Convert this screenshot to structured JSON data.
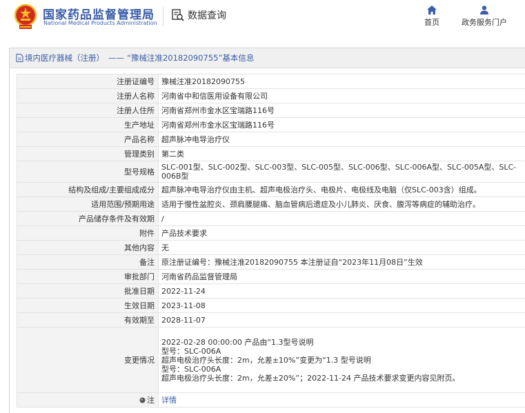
{
  "header": {
    "agency_cn": "国家药品监督管理局",
    "agency_en": "National Medical Products Administration",
    "data_query": "数据查询",
    "nav_home": "首页",
    "nav_portal": "政务服务门户"
  },
  "titlebar": {
    "category_link": "境内医疗器械（注册）",
    "separator": "——",
    "record_title": "“豫械注准20182090755”基本信息"
  },
  "rows": [
    {
      "label": "注册证编号",
      "value": "豫械注准20182090755"
    },
    {
      "label": "注册人名称",
      "value": "河南省中和信医用设备有限公司"
    },
    {
      "label": "注册人住所",
      "value": "河南省郑州市金水区宝瑞路116号"
    },
    {
      "label": "生产地址",
      "value": "河南省郑州市金水区宝瑞路116号"
    },
    {
      "label": "产品名称",
      "value": "超声脉冲电导治疗仪"
    },
    {
      "label": "管理类别",
      "value": "第二类"
    },
    {
      "label": "型号规格",
      "value": "SLC-001型、SLC-002型、SLC-003型、SLC-005型、SLC-006型、SLC-006A型、SLC-005A型、SLC-006B型"
    },
    {
      "label": "结构及组成/主要组成成分",
      "value": "超声脉冲电导治疗仪由主机、超声电极治疗头、电极片、电极线及电脑（仅SLC-003含）组成。"
    },
    {
      "label": "适用范围/预期用途",
      "value": "适用于慢性盆腔炎、颈肩腰腿痛、脑血管病后遗症及小儿肺炎、厌食、腹泻等病症的辅助治疗。"
    },
    {
      "label": "产品储存条件及有效期",
      "value": "/"
    },
    {
      "label": "附件",
      "value": "产品技术要求"
    },
    {
      "label": "其他内容",
      "value": "无"
    },
    {
      "label": "备注",
      "value": "原注册证编号：豫械注准20182090755 本注册证自“2023年11月08日”生效"
    },
    {
      "label": "审批部门",
      "value": "河南省药品监督管理局"
    },
    {
      "label": "批准日期",
      "value": "2022-11-24"
    },
    {
      "label": "生效日期",
      "value": "2023-11-08"
    },
    {
      "label": "有效期至",
      "value": "2028-11-07"
    },
    {
      "label": "变更情况",
      "value": "2022-02-28 00:00:00 产品由“1.3型号说明\n型号：SLC-006A\n超声电极治疗头长度：2m，允差±10%”变更为“1.3 型号说明\n型号：SLC-006A\n超声电极治疗头长度：2m，允差±20%”；2022-11-24 产品技术要求变更内容见附页。"
    }
  ],
  "note": {
    "label": "注",
    "link": "详情"
  },
  "icons": {
    "emblem": "national-emblem-icon",
    "query": "magnifier-doc-icon",
    "home": "home-icon",
    "portal": "user-icon",
    "doc": "document-icon",
    "note": "globe-icon"
  },
  "colors": {
    "brand_blue": "#3b5ea8",
    "emblem_red": "#d32a1f",
    "emblem_gold": "#f2c026"
  }
}
